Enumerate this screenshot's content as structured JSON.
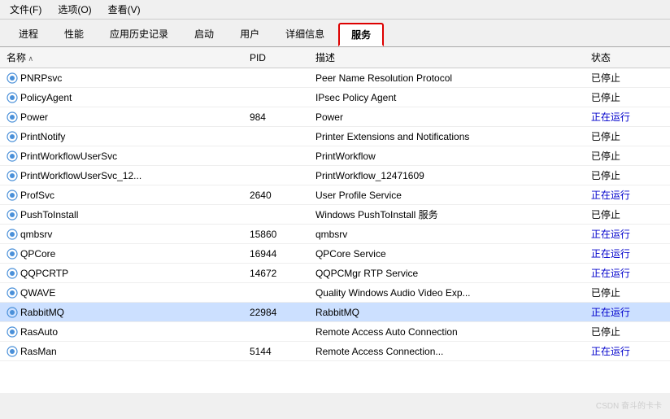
{
  "menubar": {
    "items": [
      "文件(F)",
      "选项(O)",
      "查看(V)"
    ]
  },
  "tabs": [
    {
      "label": "进程",
      "active": false
    },
    {
      "label": "性能",
      "active": false
    },
    {
      "label": "应用历史记录",
      "active": false
    },
    {
      "label": "启动",
      "active": false
    },
    {
      "label": "用户",
      "active": false
    },
    {
      "label": "详细信息",
      "active": false
    },
    {
      "label": "服务",
      "active": true
    }
  ],
  "table": {
    "columns": [
      "名称",
      "PID",
      "描述",
      "状态"
    ],
    "rows": [
      {
        "name": "PNRPsvc",
        "pid": "",
        "desc": "Peer Name Resolution Protocol",
        "status": "已停止",
        "highlighted": false
      },
      {
        "name": "PolicyAgent",
        "pid": "",
        "desc": "IPsec Policy Agent",
        "status": "已停止",
        "highlighted": false
      },
      {
        "name": "Power",
        "pid": "984",
        "desc": "Power",
        "status": "正在运行",
        "highlighted": false
      },
      {
        "name": "PrintNotify",
        "pid": "",
        "desc": "Printer Extensions and Notifications",
        "status": "已停止",
        "highlighted": false
      },
      {
        "name": "PrintWorkflowUserSvc",
        "pid": "",
        "desc": "PrintWorkflow",
        "status": "已停止",
        "highlighted": false
      },
      {
        "name": "PrintWorkflowUserSvc_12...",
        "pid": "",
        "desc": "PrintWorkflow_12471609",
        "status": "已停止",
        "highlighted": false
      },
      {
        "name": "ProfSvc",
        "pid": "2640",
        "desc": "User Profile Service",
        "status": "正在运行",
        "highlighted": false
      },
      {
        "name": "PushToInstall",
        "pid": "",
        "desc": "Windows PushToInstall 服务",
        "status": "已停止",
        "highlighted": false
      },
      {
        "name": "qmbsrv",
        "pid": "15860",
        "desc": "qmbsrv",
        "status": "正在运行",
        "highlighted": false
      },
      {
        "name": "QPCore",
        "pid": "16944",
        "desc": "QPCore Service",
        "status": "正在运行",
        "highlighted": false
      },
      {
        "name": "QQPCRTP",
        "pid": "14672",
        "desc": "QQPCMgr RTP Service",
        "status": "正在运行",
        "highlighted": false
      },
      {
        "name": "QWAVE",
        "pid": "",
        "desc": "Quality Windows Audio Video Exp...",
        "status": "已停止",
        "highlighted": false
      },
      {
        "name": "RabbitMQ",
        "pid": "22984",
        "desc": "RabbitMQ",
        "status": "正在运行",
        "highlighted": true
      },
      {
        "name": "RasAuto",
        "pid": "",
        "desc": "Remote Access Auto Connection",
        "status": "已停止",
        "highlighted": false
      },
      {
        "name": "RasMan",
        "pid": "5144",
        "desc": "Remote Access Connection...",
        "status": "正在运行",
        "highlighted": false
      }
    ]
  },
  "watermark": "CSDN 奋斗的卡卡"
}
